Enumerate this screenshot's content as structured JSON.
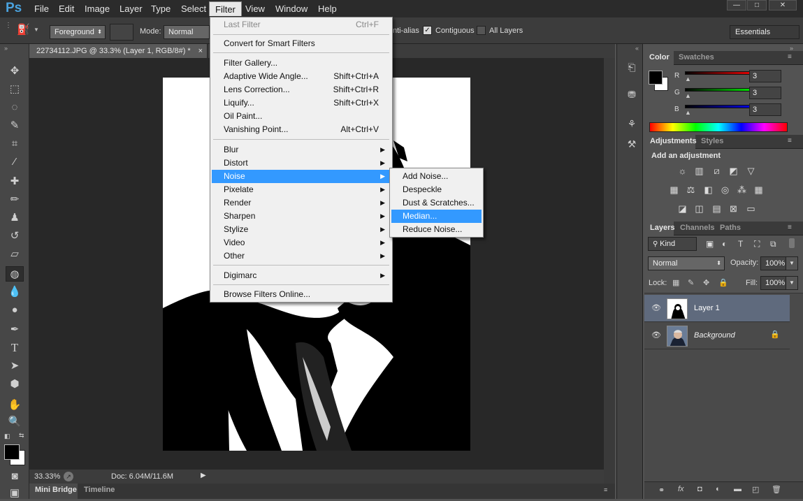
{
  "app": {
    "logo": "Ps"
  },
  "menubar": {
    "items": [
      "File",
      "Edit",
      "Image",
      "Layer",
      "Type",
      "Select",
      "Filter",
      "View",
      "Window",
      "Help"
    ],
    "active": "Filter",
    "window_controls": [
      "—",
      "□",
      "✕"
    ]
  },
  "options_bar": {
    "fill_source": "Foreground",
    "mode_label": "Mode:",
    "mode_value": "Normal",
    "antialias_label": "nti-alias",
    "contiguous_label": "Contiguous",
    "all_layers_label": "All Layers",
    "workspace": "Essentials"
  },
  "document": {
    "tab_title": "22734112.JPG @ 33.3% (Layer 1, RGB/8#) *",
    "close": "×",
    "zoom": "33.33%",
    "doc_info": "Doc: 6.04M/11.6M"
  },
  "bottom_tabs": [
    "Mini Bridge",
    "Timeline"
  ],
  "filter_menu": {
    "items": [
      {
        "label": "Last Filter",
        "shortcut": "Ctrl+F",
        "disabled": true
      },
      {
        "label": "Convert for Smart Filters"
      },
      {
        "label": "Filter Gallery..."
      },
      {
        "label": "Adaptive Wide Angle...",
        "shortcut": "Shift+Ctrl+A"
      },
      {
        "label": "Lens Correction...",
        "shortcut": "Shift+Ctrl+R"
      },
      {
        "label": "Liquify...",
        "shortcut": "Shift+Ctrl+X"
      },
      {
        "label": "Oil Paint..."
      },
      {
        "label": "Vanishing Point...",
        "shortcut": "Alt+Ctrl+V"
      },
      {
        "label": "Blur",
        "submenu": true
      },
      {
        "label": "Distort",
        "submenu": true
      },
      {
        "label": "Noise",
        "submenu": true,
        "highlighted": true
      },
      {
        "label": "Pixelate",
        "submenu": true
      },
      {
        "label": "Render",
        "submenu": true
      },
      {
        "label": "Sharpen",
        "submenu": true
      },
      {
        "label": "Stylize",
        "submenu": true
      },
      {
        "label": "Video",
        "submenu": true
      },
      {
        "label": "Other",
        "submenu": true
      },
      {
        "label": "Digimarc",
        "submenu": true
      },
      {
        "label": "Browse Filters Online..."
      }
    ]
  },
  "noise_submenu": {
    "items": [
      {
        "label": "Add Noise..."
      },
      {
        "label": "Despeckle"
      },
      {
        "label": "Dust & Scratches..."
      },
      {
        "label": "Median...",
        "highlighted": true
      },
      {
        "label": "Reduce Noise..."
      }
    ]
  },
  "color_panel": {
    "tabs": [
      "Color",
      "Swatches"
    ],
    "channels": [
      {
        "label": "R",
        "value": "3"
      },
      {
        "label": "G",
        "value": "3"
      },
      {
        "label": "B",
        "value": "3"
      }
    ]
  },
  "adjustments_panel": {
    "tabs": [
      "Adjustments",
      "Styles"
    ],
    "heading": "Add an adjustment"
  },
  "layers_panel": {
    "tabs": [
      "Layers",
      "Channels",
      "Paths"
    ],
    "filter_kind": "Kind",
    "blend_mode": "Normal",
    "opacity_label": "Opacity:",
    "opacity_value": "100%",
    "lock_label": "Lock:",
    "fill_label": "Fill:",
    "fill_value": "100%",
    "layers": [
      {
        "name": "Layer 1",
        "selected": true
      },
      {
        "name": "Background",
        "locked": true
      }
    ]
  },
  "colors": {
    "accent": "#3399ff",
    "menubar": "#2b2b2b",
    "canvas_bg": "#282828"
  }
}
